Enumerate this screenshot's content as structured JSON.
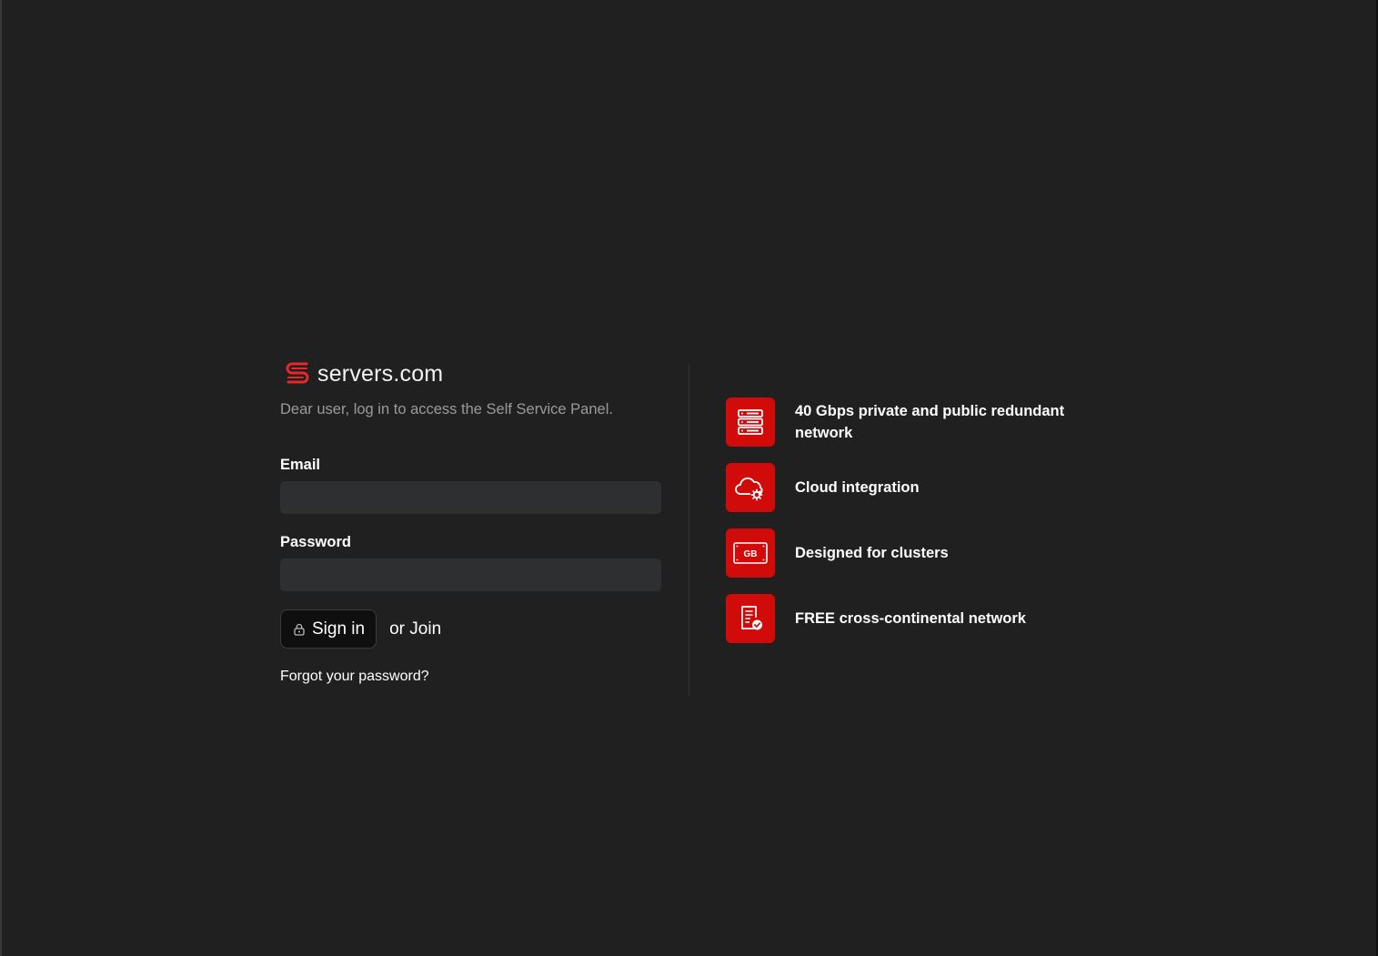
{
  "brand": {
    "name": "servers.com",
    "accent_color": "#d10a0a"
  },
  "login": {
    "subtitle": "Dear user, log in to access the Self Service Panel.",
    "email_label": "Email",
    "email_value": "",
    "password_label": "Password",
    "password_value": "",
    "signin_label": "Sign in",
    "join_label": "or Join",
    "forgot_label": "Forgot your password?"
  },
  "features": [
    {
      "icon": "server-stack-icon",
      "text": "40 Gbps private and public redundant network"
    },
    {
      "icon": "cloud-gear-icon",
      "text": "Cloud integration"
    },
    {
      "icon": "gb-memory-icon",
      "text": "Designed for clusters",
      "icon_text": "GB"
    },
    {
      "icon": "document-check-icon",
      "text": "FREE cross-continental network"
    }
  ]
}
